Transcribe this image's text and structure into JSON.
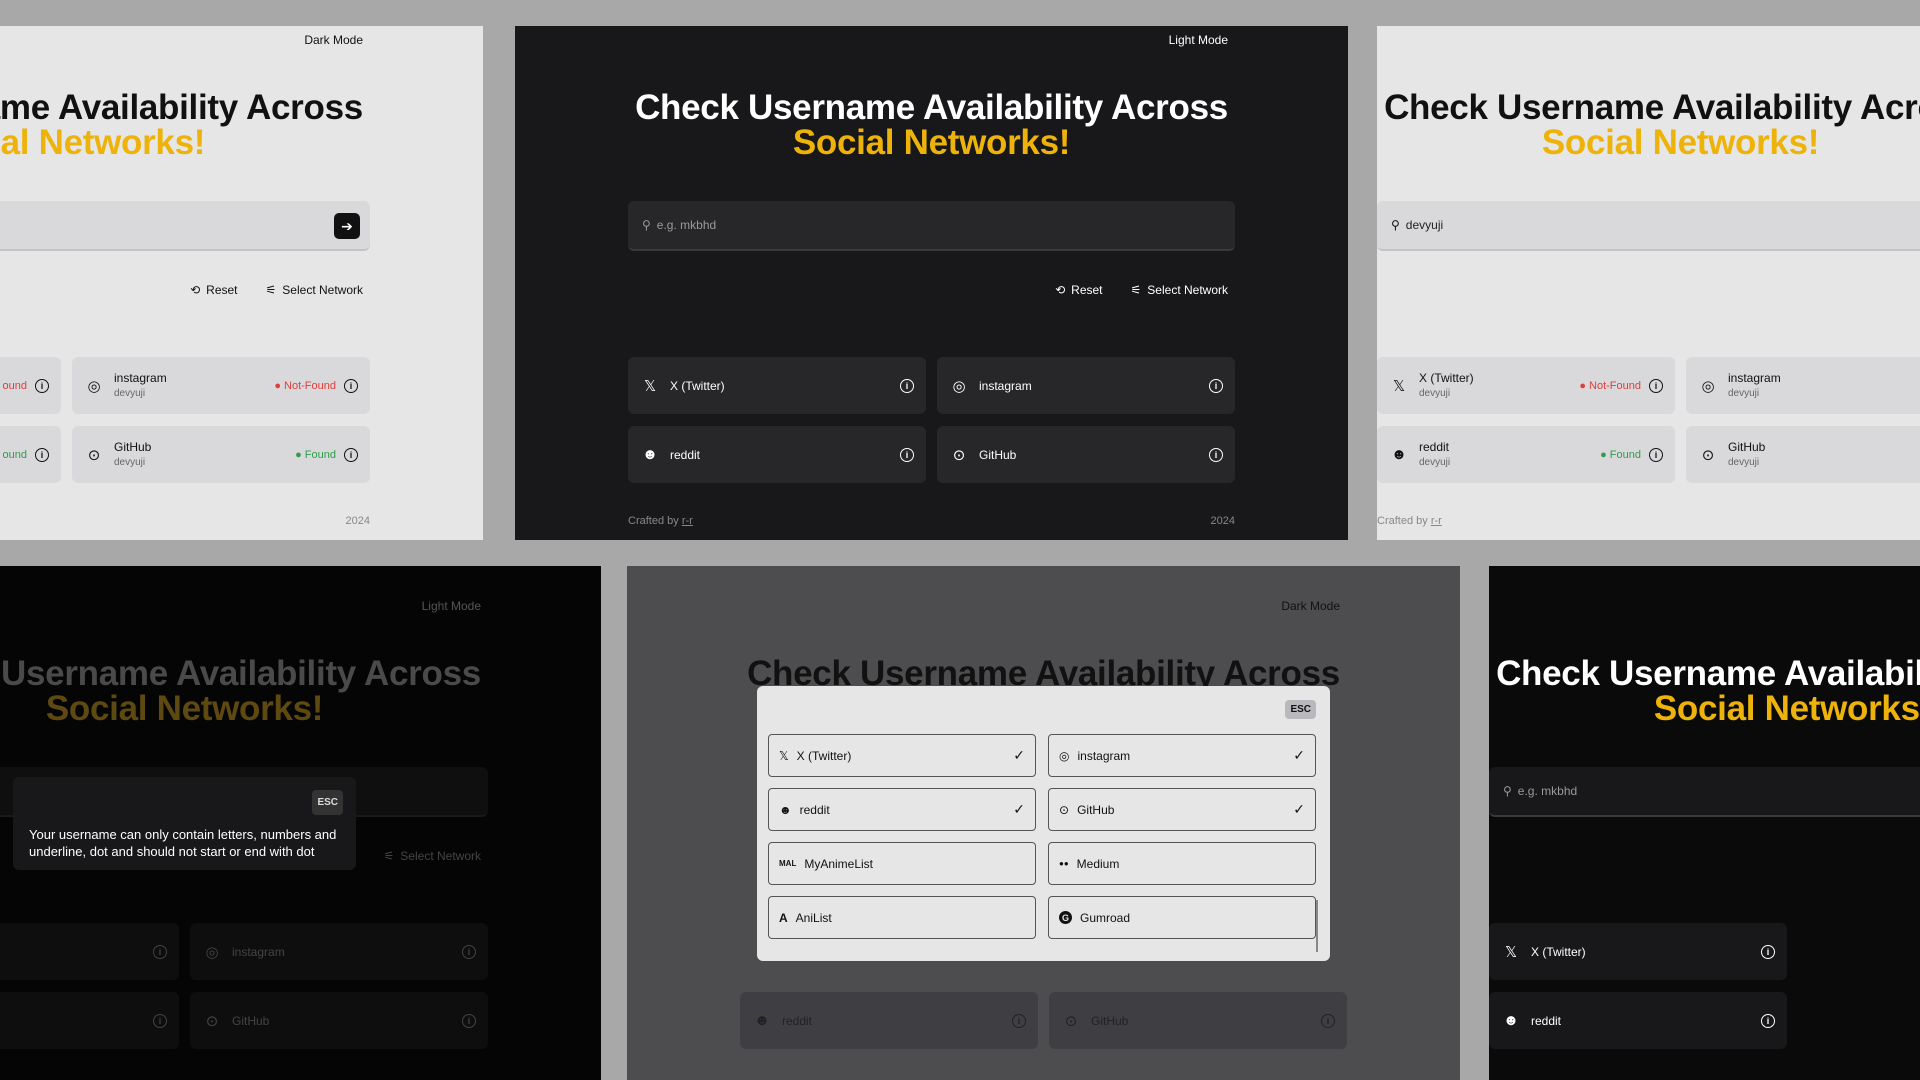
{
  "header": {
    "title_line1": "Check Username Availability Across",
    "title_line2": "Social Networks!",
    "dark_mode_label": "Dark Mode",
    "light_mode_label": "Light Mode"
  },
  "search": {
    "placeholder": "e.g. mkbhd",
    "filled_value": "devyuji",
    "submit_icon": "arrow-right-icon"
  },
  "actions": {
    "reset_label": "Reset",
    "select_network_label": "Select Network"
  },
  "networks": [
    {
      "name": "X (Twitter)",
      "icon": "x-icon",
      "glyph": "𝕏"
    },
    {
      "name": "instagram",
      "icon": "instagram-icon",
      "glyph": "◎"
    },
    {
      "name": "reddit",
      "icon": "reddit-icon",
      "glyph": "☻"
    },
    {
      "name": "GitHub",
      "icon": "github-icon",
      "glyph": "⊙"
    }
  ],
  "results": {
    "username": "devyuji",
    "x_status": "Not-Found",
    "instagram_status": "Not-Found",
    "reddit_status": "Found",
    "github_status": "Found",
    "found_partial": "ound",
    "notfound_partial": "ound"
  },
  "footer": {
    "crafted_label": "Crafted by",
    "crafted_link": "r-r",
    "year": "2024"
  },
  "tooltip": {
    "esc_label": "ESC",
    "message": "Your username can only contain letters, numbers and underline, dot and should not start or end with dot"
  },
  "network_modal": {
    "esc_label": "ESC",
    "options": [
      {
        "name": "X (Twitter)",
        "glyph": "𝕏",
        "checked": true
      },
      {
        "name": "instagram",
        "glyph": "◎",
        "checked": true
      },
      {
        "name": "reddit",
        "glyph": "☻",
        "checked": true
      },
      {
        "name": "GitHub",
        "glyph": "⊙",
        "checked": true
      },
      {
        "name": "MyAnimeList",
        "glyph": "MAL",
        "checked": false
      },
      {
        "name": "Medium",
        "glyph": "●●",
        "checked": false
      },
      {
        "name": "AniList",
        "glyph": "A",
        "checked": false
      },
      {
        "name": "Gumroad",
        "glyph": "G",
        "checked": false
      }
    ]
  },
  "colors": {
    "accent": "#eeb30a",
    "found": "#2e9c4c",
    "not_found": "#e23b3b"
  }
}
